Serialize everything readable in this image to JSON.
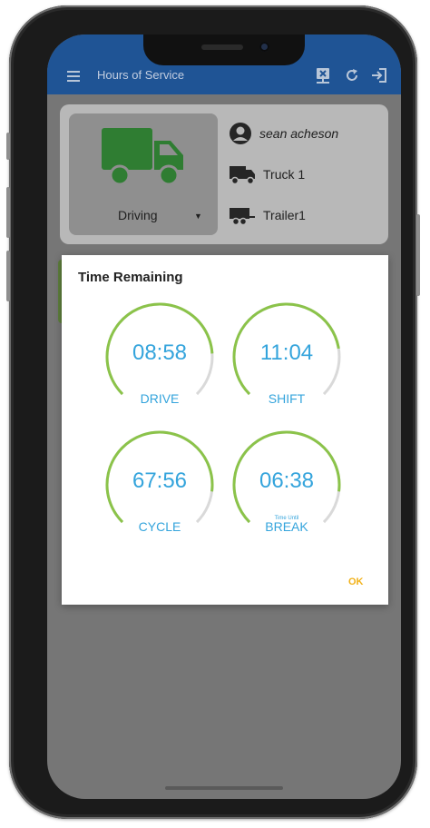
{
  "app": {
    "title": "Hours of Service",
    "toolbar_icons": [
      "no-connection-icon",
      "refresh-icon",
      "logout-icon"
    ],
    "accent_color": "#1f5495"
  },
  "status_card": {
    "status": "Driving",
    "truck_color": "#2f7d32",
    "driver_name": "sean acheson",
    "truck": "Truck 1",
    "trailer": "Trailer1"
  },
  "dialog": {
    "title": "Time Remaining",
    "gauge_color": "#8bc34a",
    "track_color": "#d9d9d9",
    "value_color": "#34a4dc",
    "gauges": [
      {
        "value": "08:58",
        "label": "DRIVE",
        "sub": "",
        "fraction": 0.82
      },
      {
        "value": "11:04",
        "label": "SHIFT",
        "sub": "",
        "fraction": 0.8
      },
      {
        "value": "67:56",
        "label": "CYCLE",
        "sub": "",
        "fraction": 0.86
      },
      {
        "value": "06:38",
        "label": "BREAK",
        "sub": "Time Until",
        "fraction": 0.86
      }
    ],
    "ok_label": "OK"
  }
}
